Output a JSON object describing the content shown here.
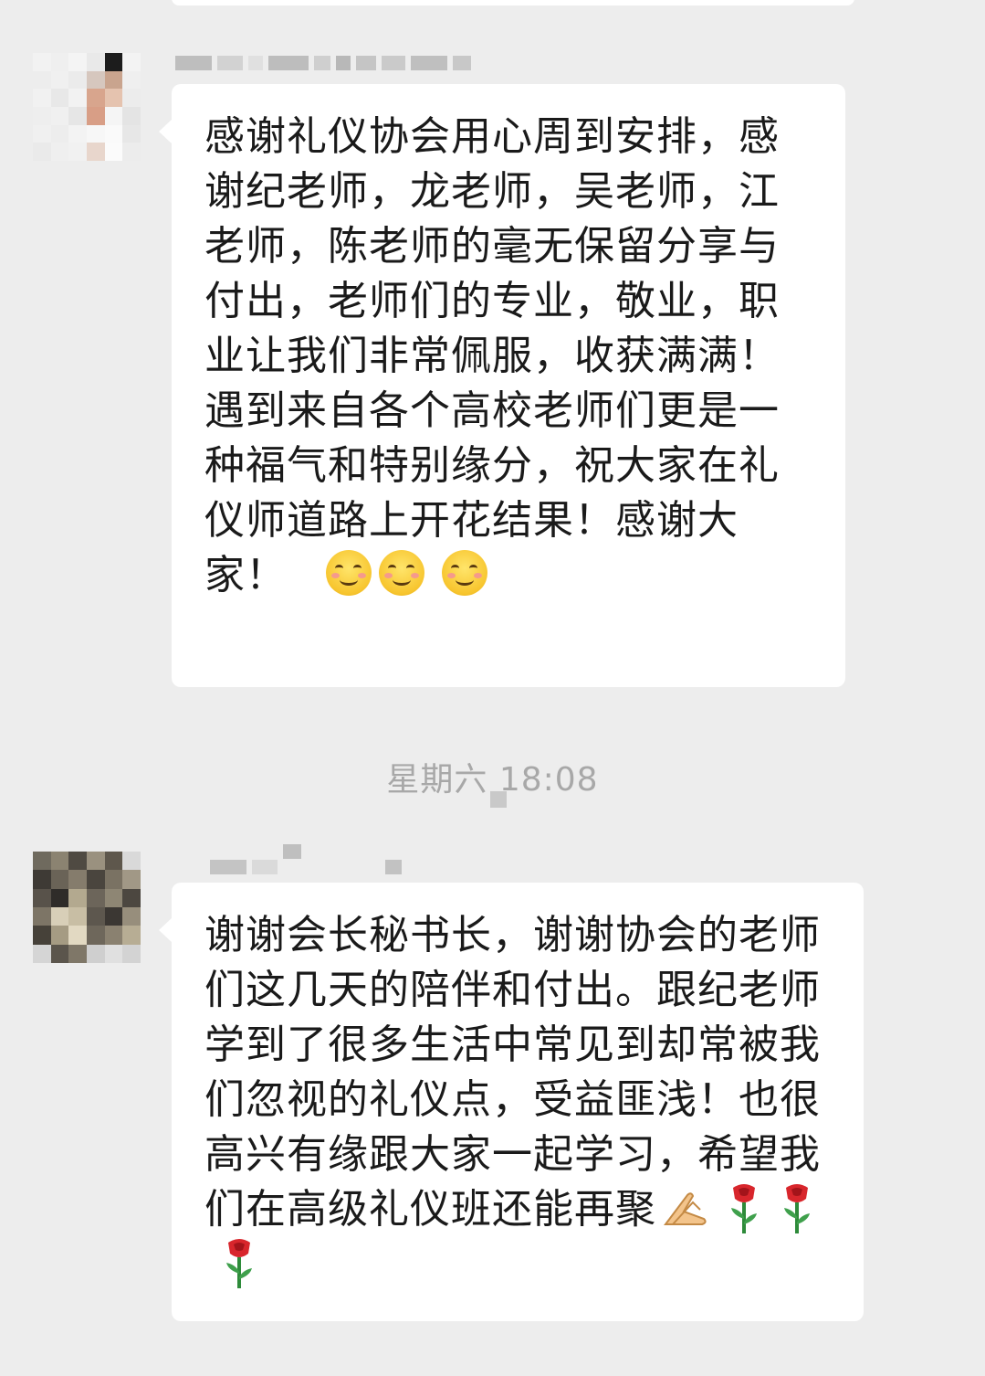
{
  "messages": [
    {
      "sender": "",
      "text": "感谢礼仪协会用心周到安排，感谢纪老师，龙老师，吴老师，江老师，陈老师的毫无保留分享与付出，老师们的专业，敬业，职业让我们非常佩服，收获满满！遇到来自各个高校老师们更是一种福气和特别缘分，祝大家在礼仪师道路上开花结果！感谢大家！",
      "emojis": [
        "smiling-face-icon",
        "smiling-face-icon",
        "smiling-face-icon"
      ]
    },
    {
      "sender": "",
      "text": "谢谢会长秘书长，谢谢协会的老师们这几天的陪伴和付出。跟纪老师学到了很多生活中常见到却常被我们忽视的礼仪点，受益匪浅！也很高兴有缘跟大家一起学习，希望我们在高级礼仪班还能再聚",
      "emojis": [
        "praying-hands-icon",
        "rose-icon",
        "rose-icon",
        "rose-icon"
      ]
    }
  ],
  "timestamp": "星期六 18:08",
  "colors": {
    "background": "#EDEDED",
    "bubble": "#FFFFFF",
    "text": "#1A1A1A",
    "timestamp": "#A8A8A8"
  }
}
